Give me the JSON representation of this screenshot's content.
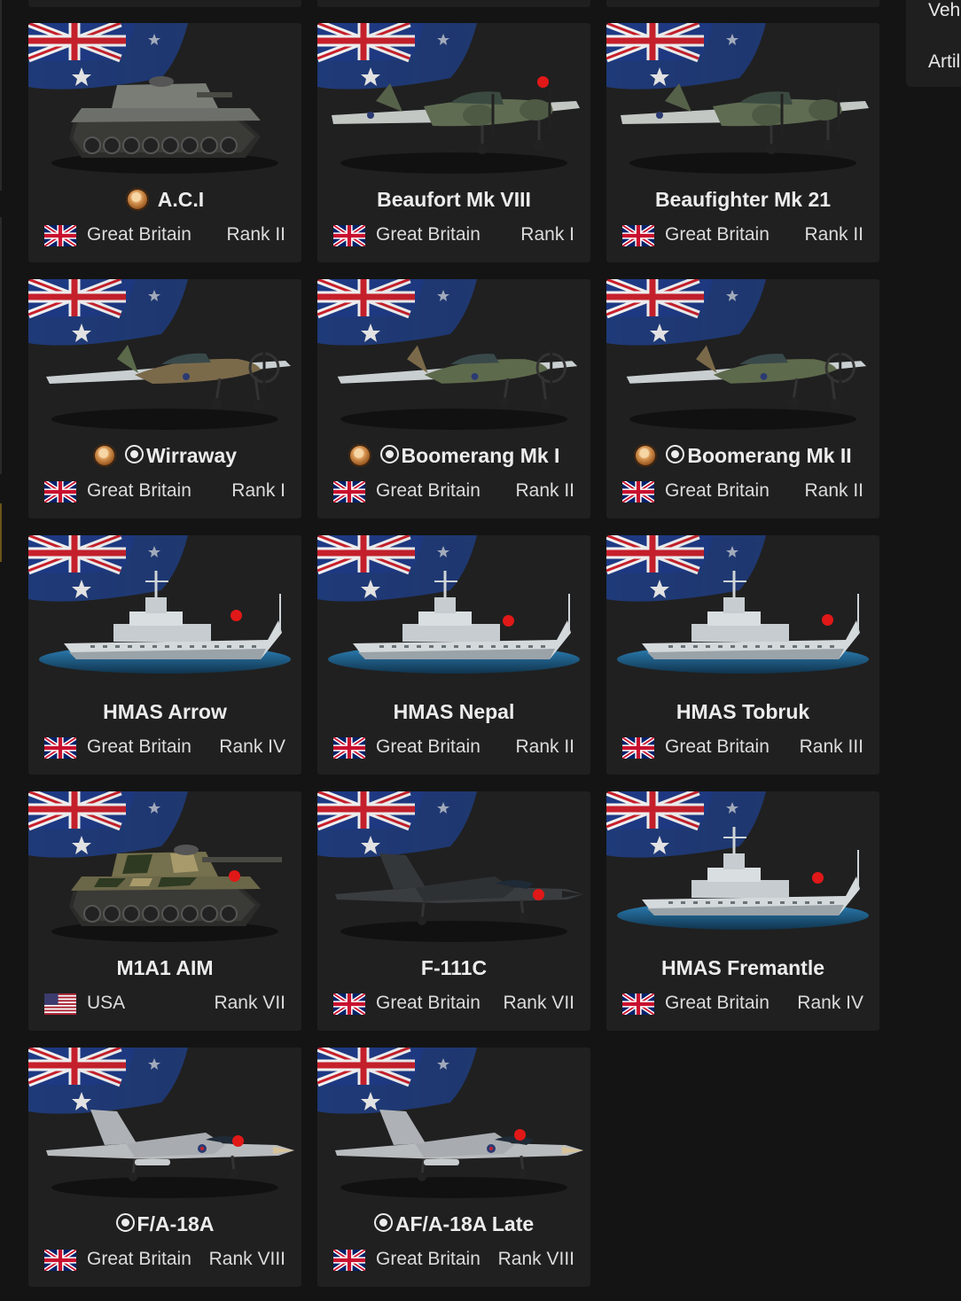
{
  "side_panel": {
    "items": [
      "Vehicles",
      "Artillery"
    ]
  },
  "colors": {
    "card_bg": "#202020",
    "page_bg": "#141414",
    "new_dot": "#e11818"
  },
  "vehicles": [
    {
      "name": "A.C.I",
      "kind": "tank-icon",
      "medal": true,
      "premium": false,
      "new": false,
      "country": "Great Britain",
      "flag": "uk-flag-icon",
      "rank": "Rank II"
    },
    {
      "name": "Beaufort Mk VIII",
      "kind": "bomber-icon",
      "medal": false,
      "premium": false,
      "new": true,
      "country": "Great Britain",
      "flag": "uk-flag-icon",
      "rank": "Rank I"
    },
    {
      "name": "Beaufighter Mk 21",
      "kind": "bomber-icon",
      "medal": false,
      "premium": false,
      "new": true,
      "country": "Great Britain",
      "flag": "uk-flag-icon",
      "rank": "Rank II"
    },
    {
      "name": "Wirraway",
      "kind": "fighter-prop-icon",
      "medal": true,
      "premium": true,
      "new": false,
      "country": "Great Britain",
      "flag": "uk-flag-icon",
      "rank": "Rank I"
    },
    {
      "name": "Boomerang Mk I",
      "kind": "fighter-prop-icon",
      "medal": true,
      "premium": true,
      "new": false,
      "country": "Great Britain",
      "flag": "uk-flag-icon",
      "rank": "Rank II"
    },
    {
      "name": "Boomerang Mk II",
      "kind": "fighter-prop-icon",
      "medal": true,
      "premium": true,
      "new": false,
      "country": "Great Britain",
      "flag": "uk-flag-icon",
      "rank": "Rank II"
    },
    {
      "name": "HMAS Arrow",
      "kind": "ship-icon",
      "medal": false,
      "premium": false,
      "new": true,
      "country": "Great Britain",
      "flag": "uk-flag-icon",
      "rank": "Rank IV"
    },
    {
      "name": "HMAS Nepal",
      "kind": "ship-icon",
      "medal": false,
      "premium": false,
      "new": true,
      "country": "Great Britain",
      "flag": "uk-flag-icon",
      "rank": "Rank II"
    },
    {
      "name": "HMAS Tobruk",
      "kind": "ship-icon",
      "medal": false,
      "premium": false,
      "new": true,
      "country": "Great Britain",
      "flag": "uk-flag-icon",
      "rank": "Rank III"
    },
    {
      "name": "M1A1 AIM",
      "kind": "tank-icon",
      "medal": false,
      "premium": false,
      "new": true,
      "country": "USA",
      "flag": "usa-flag-icon",
      "rank": "Rank VII"
    },
    {
      "name": "F-111C",
      "kind": "jet-icon",
      "medal": false,
      "premium": false,
      "new": true,
      "country": "Great Britain",
      "flag": "uk-flag-icon",
      "rank": "Rank VII"
    },
    {
      "name": "HMAS Fremantle",
      "kind": "ship-icon",
      "medal": false,
      "premium": false,
      "new": true,
      "country": "Great Britain",
      "flag": "uk-flag-icon",
      "rank": "Rank IV"
    },
    {
      "name": "F/A-18A",
      "kind": "jet-icon",
      "medal": false,
      "premium": true,
      "new": true,
      "country": "Great Britain",
      "flag": "uk-flag-icon",
      "rank": "Rank VIII"
    },
    {
      "name": "AF/A-18A Late",
      "kind": "jet-icon",
      "medal": false,
      "premium": true,
      "new": true,
      "country": "Great Britain",
      "flag": "uk-flag-icon",
      "rank": "Rank VIII"
    }
  ]
}
